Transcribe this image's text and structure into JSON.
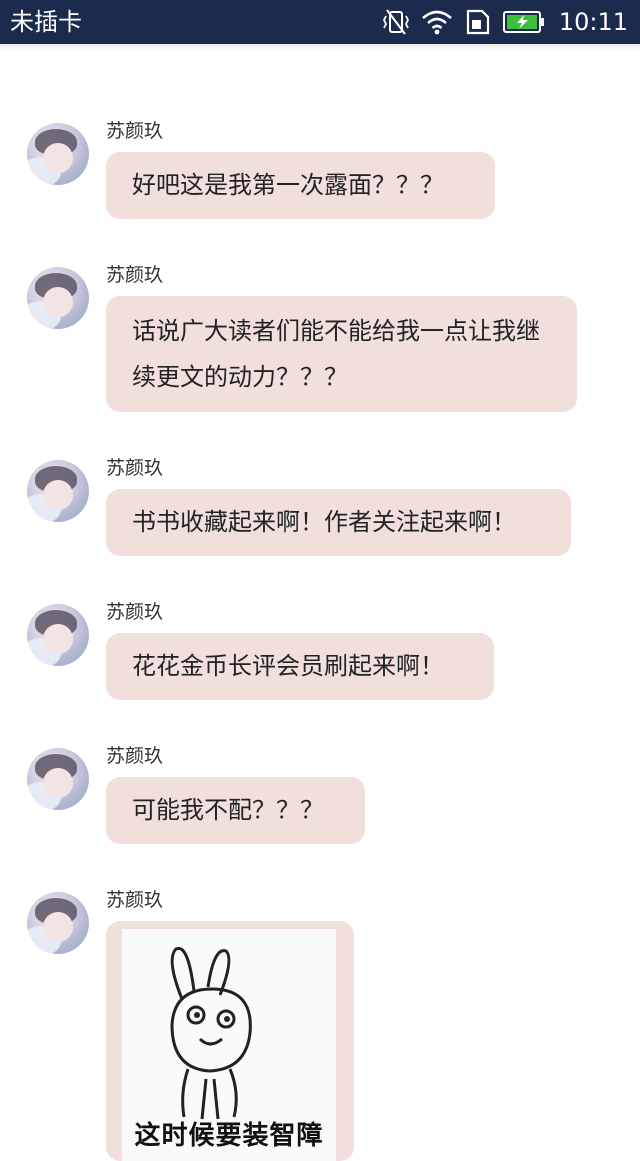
{
  "status_bar": {
    "carrier": "未插卡",
    "time": "10:11",
    "icons": [
      "vibrate-icon",
      "wifi-icon",
      "no-sim-icon",
      "battery-charging-icon"
    ]
  },
  "messages": [
    {
      "sender": "苏颜玖",
      "text": "好吧这是我第一次露面？？？"
    },
    {
      "sender": "苏颜玖",
      "text": "话说广大读者们能不能给我一点让我继续更文的动力？？？"
    },
    {
      "sender": "苏颜玖",
      "text": "书书收藏起来啊！作者关注起来啊！"
    },
    {
      "sender": "苏颜玖",
      "text": "花花金币长评会员刷起来啊！"
    },
    {
      "sender": "苏颜玖",
      "text": "可能我不配？？？"
    },
    {
      "sender": "苏颜玖",
      "sticker_caption": "这时候要装智障"
    }
  ],
  "colors": {
    "status_bar_bg": "#1c2a4e",
    "bubble_bg": "#f1dfdc",
    "battery_fill": "#3cbf3c"
  }
}
